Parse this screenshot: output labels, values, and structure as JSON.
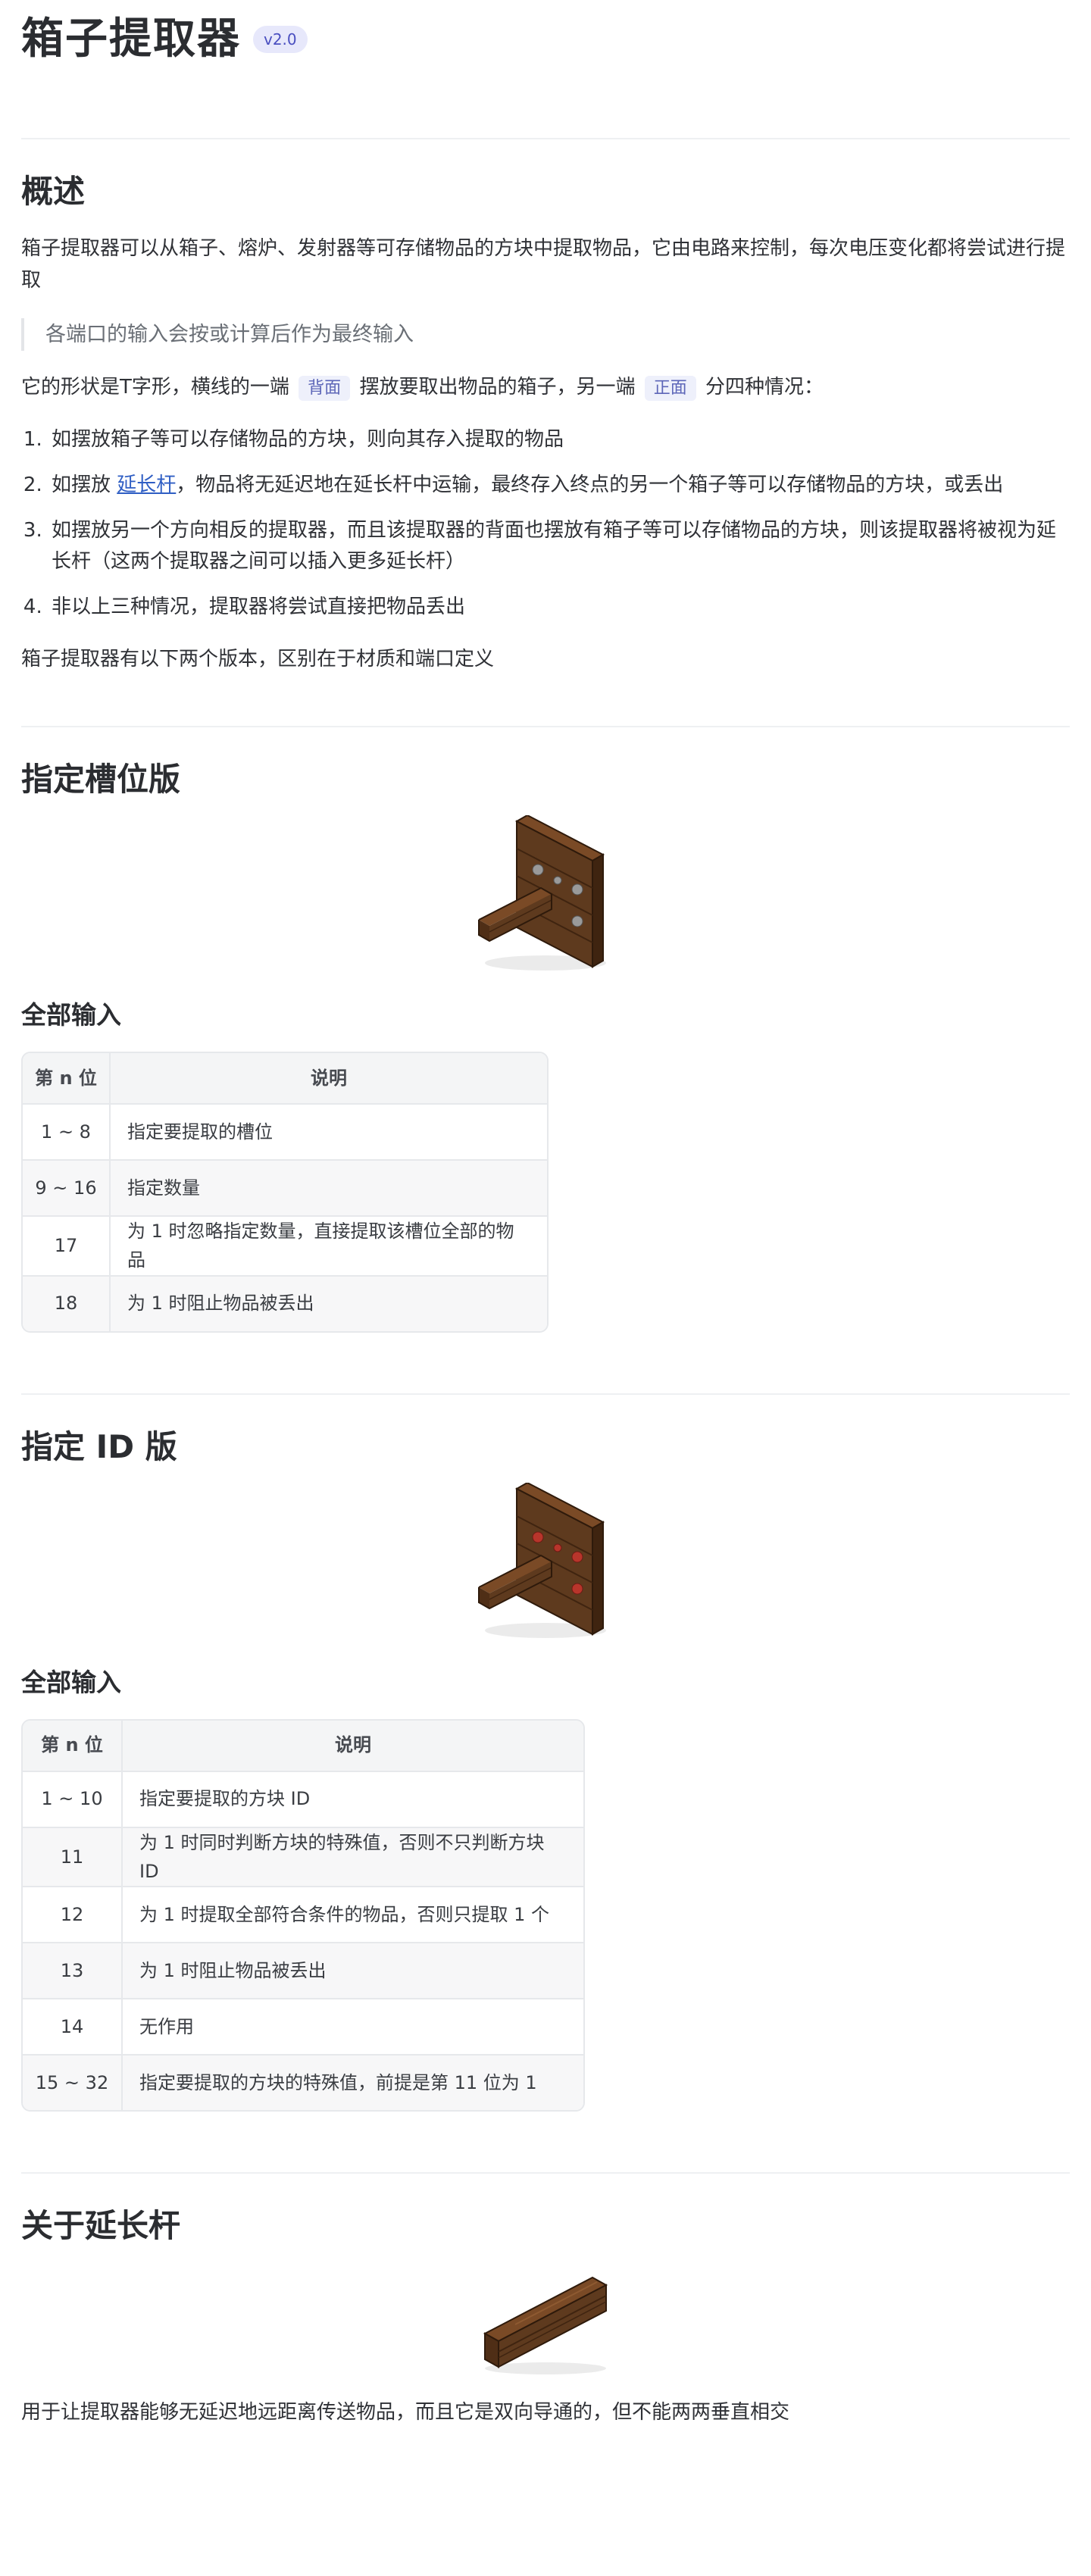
{
  "header": {
    "title": "箱子提取器",
    "version": "v2.0"
  },
  "overview": {
    "heading": "概述",
    "paragraph1": "箱子提取器可以从箱子、熔炉、发射器等可存储物品的方块中提取物品，它由电路来控制，每次电压变化都将尝试进行提取",
    "quote": "各端口的输入会按或计算后作为最终输入",
    "shape_text_a": "它的形状是T字形，横线的一端",
    "tag_back": "背面",
    "shape_text_b": "摆放要取出物品的箱子，另一端",
    "tag_front": "正面",
    "shape_text_c": "分四种情况：",
    "list": [
      {
        "text": "如摆放箱子等可以存储物品的方块，则向其存入提取的物品"
      },
      {
        "pre": "如摆放",
        "link": "延长杆",
        "post": "，物品将无延迟地在延长杆中运输，最终存入终点的另一个箱子等可以存储物品的方块，或丢出"
      },
      {
        "text": "如摆放另一个方向相反的提取器，而且该提取器的背面也摆放有箱子等可以存储物品的方块，则该提取器将被视为延长杆（这两个提取器之间可以插入更多延长杆）"
      },
      {
        "text": "非以上三种情况，提取器将尝试直接把物品丢出"
      }
    ],
    "versions_text": "箱子提取器有以下两个版本，区别在于材质和端口定义"
  },
  "slot_version": {
    "heading": "指定槽位版",
    "image_icon": "slot-extractor-icon",
    "stud_color": "#9a9a9a",
    "inputs_heading": "全部输入",
    "table": {
      "col1": "第 n 位",
      "col2": "说明",
      "rows": [
        {
          "bit": "1 ~ 8",
          "desc": "指定要提取的槽位"
        },
        {
          "bit": "9 ~ 16",
          "desc": "指定数量"
        },
        {
          "bit": "17",
          "desc": "为 1 时忽略指定数量，直接提取该槽位全部的物品"
        },
        {
          "bit": "18",
          "desc": "为 1 时阻止物品被丢出"
        }
      ]
    }
  },
  "id_version": {
    "heading": "指定 ID 版",
    "image_icon": "id-extractor-icon",
    "stud_color": "#b8352b",
    "inputs_heading": "全部输入",
    "table": {
      "col1": "第 n 位",
      "col2": "说明",
      "rows": [
        {
          "bit": "1 ~ 10",
          "desc": "指定要提取的方块 ID"
        },
        {
          "bit": "11",
          "desc": "为 1 时同时判断方块的特殊值，否则不只判断方块 ID"
        },
        {
          "bit": "12",
          "desc": "为 1 时提取全部符合条件的物品，否则只提取 1 个"
        },
        {
          "bit": "13",
          "desc": "为 1 时阻止物品被丢出"
        },
        {
          "bit": "14",
          "desc": "无作用"
        },
        {
          "bit": "15 ~ 32",
          "desc": "指定要提取的方块的特殊值，前提是第 11 位为 1"
        }
      ]
    }
  },
  "extension_rod": {
    "heading": "关于延长杆",
    "image_icon": "extension-rod-icon",
    "description": "用于让提取器能够无延迟地远距离传送物品，而且它是双向导通的，但不能两两垂直相交"
  }
}
